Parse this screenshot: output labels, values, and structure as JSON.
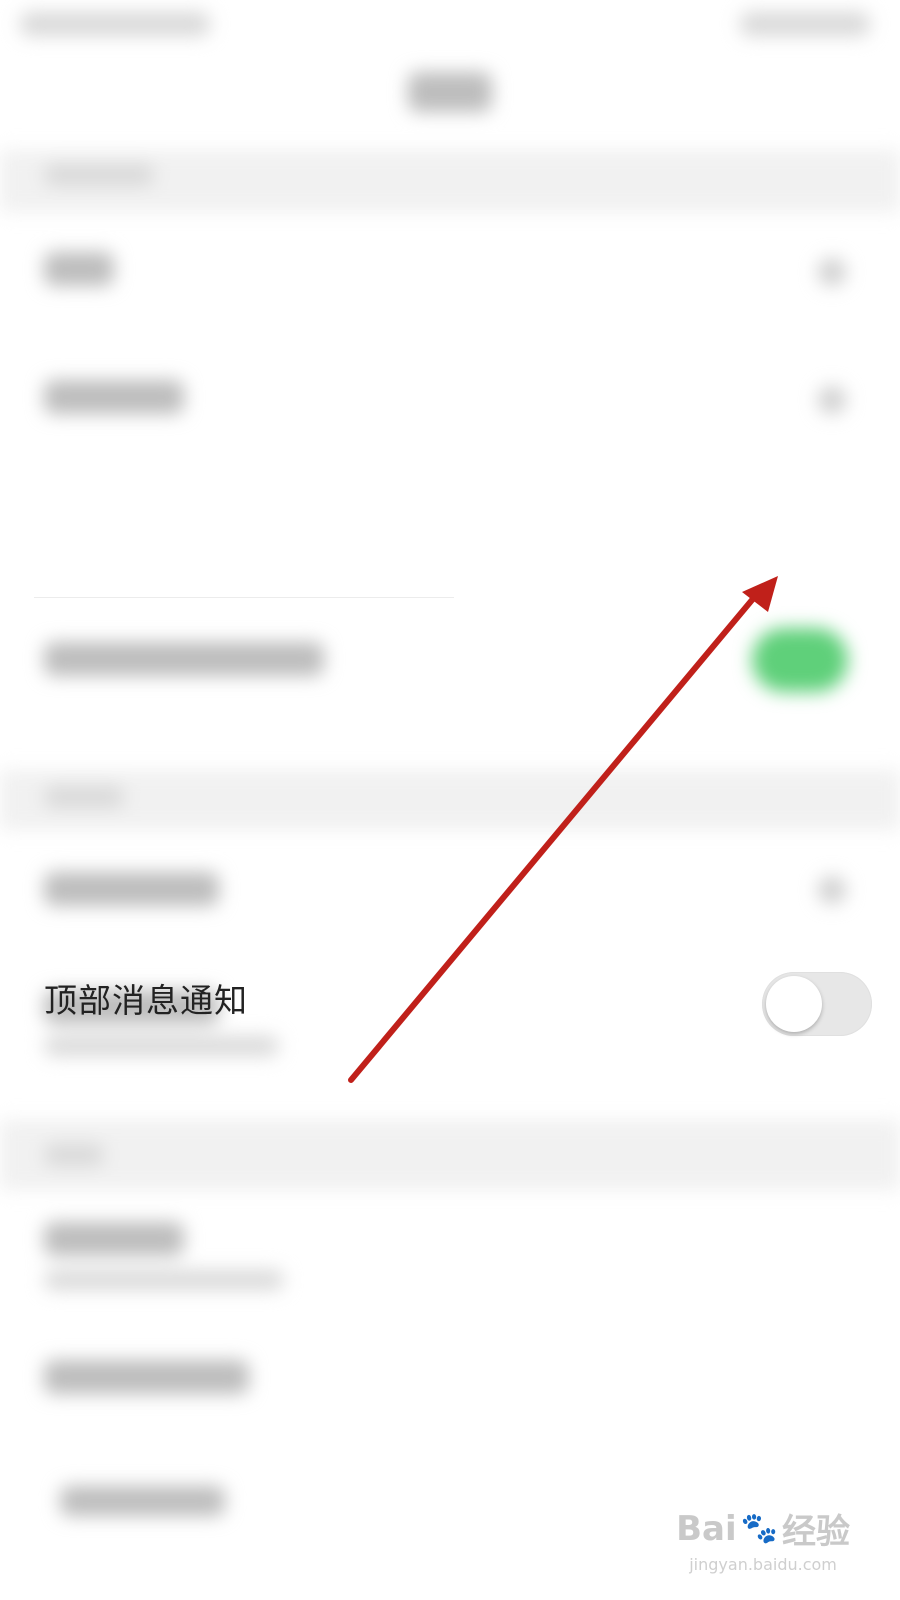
{
  "setting_row": {
    "label": "顶部消息通知",
    "toggle_state": "off"
  },
  "toggle": {
    "off_track_color": "#e7e7e7",
    "knob_color": "#ffffff"
  },
  "annotation": {
    "arrow_color": "#c0201a"
  },
  "watermark": {
    "brand": "Bai",
    "paw": "🐾",
    "brand_cn": "经验",
    "url": "jingyan.baidu.com"
  }
}
